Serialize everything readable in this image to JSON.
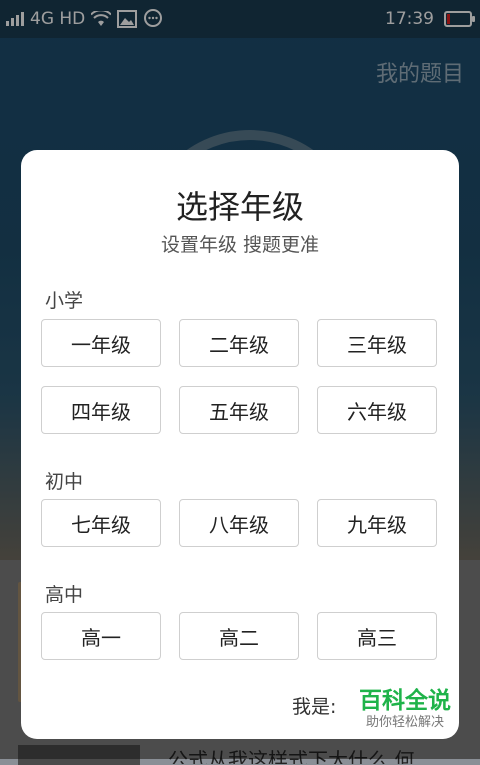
{
  "status_bar": {
    "network": "4G HD",
    "time": "17:39",
    "icons": [
      "signal-icon",
      "wifi-icon",
      "image-icon",
      "chat-icon",
      "battery-icon"
    ]
  },
  "background": {
    "my_questions": "我的题目",
    "partial_text": "公式从我这样式下大什么 何"
  },
  "dialog": {
    "title": "选择年级",
    "subtitle": "设置年级 搜题更准",
    "sections": [
      {
        "label": "小学",
        "grades": [
          "一年级",
          "二年级",
          "三年级",
          "四年级",
          "五年级",
          "六年级"
        ]
      },
      {
        "label": "初中",
        "grades": [
          "七年级",
          "八年级",
          "九年级"
        ]
      },
      {
        "label": "高中",
        "grades": [
          "高一",
          "高二",
          "高三"
        ]
      }
    ],
    "footer_text": "我是:"
  },
  "watermark": {
    "main": "百科全说",
    "sub": "助你轻松解决"
  },
  "colors": {
    "accent_green": "#1fb34a",
    "battery_red": "#e02020"
  }
}
